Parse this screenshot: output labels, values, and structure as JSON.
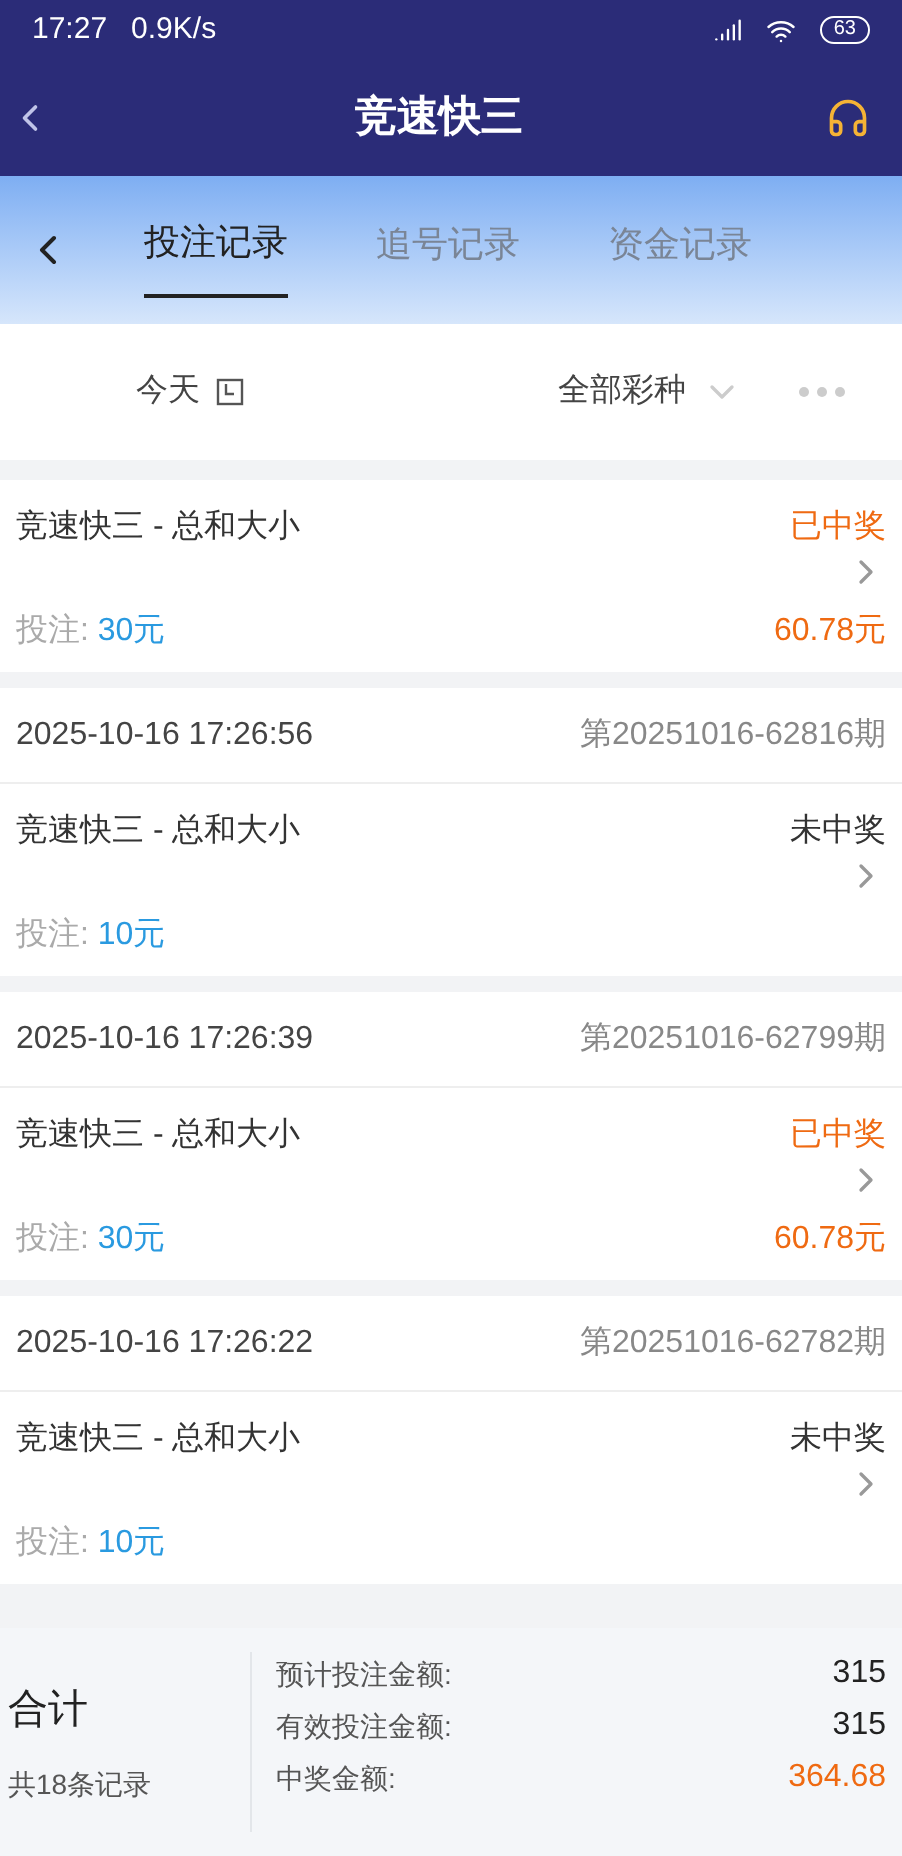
{
  "status_bar": {
    "time": "17:27",
    "speed": "0.9K/s",
    "battery": "63"
  },
  "header": {
    "title": "竞速快三"
  },
  "tabs": [
    {
      "label": "投注记录",
      "selected": true
    },
    {
      "label": "追号记录",
      "selected": false
    },
    {
      "label": "资金记录",
      "selected": false
    }
  ],
  "filters": {
    "date": "今天",
    "game": "全部彩种"
  },
  "bets": [
    {
      "game": "竞速快三 - 总和大小",
      "status": "已中奖",
      "won": true,
      "stake_label": "投注:",
      "stake": "30元",
      "prize": "60.78元"
    },
    {
      "time": "2025-10-16 17:26:56",
      "period": "第20251016-62816期",
      "game": "竞速快三 - 总和大小",
      "status": "未中奖",
      "won": false,
      "stake_label": "投注:",
      "stake": "10元"
    },
    {
      "time": "2025-10-16 17:26:39",
      "period": "第20251016-62799期",
      "game": "竞速快三 - 总和大小",
      "status": "已中奖",
      "won": true,
      "stake_label": "投注:",
      "stake": "30元",
      "prize": "60.78元"
    },
    {
      "time": "2025-10-16 17:26:22",
      "period": "第20251016-62782期",
      "game": "竞速快三 - 总和大小",
      "status": "未中奖",
      "won": false,
      "stake_label": "投注:",
      "stake": "10元"
    }
  ],
  "summary": {
    "title": "合计",
    "count": "共18条记录",
    "rows": [
      {
        "label": "预计投注金额:",
        "value": "315",
        "highlight": false
      },
      {
        "label": "有效投注金额:",
        "value": "315",
        "highlight": false
      },
      {
        "label": "中奖金额:",
        "value": "364.68",
        "highlight": true
      }
    ]
  }
}
